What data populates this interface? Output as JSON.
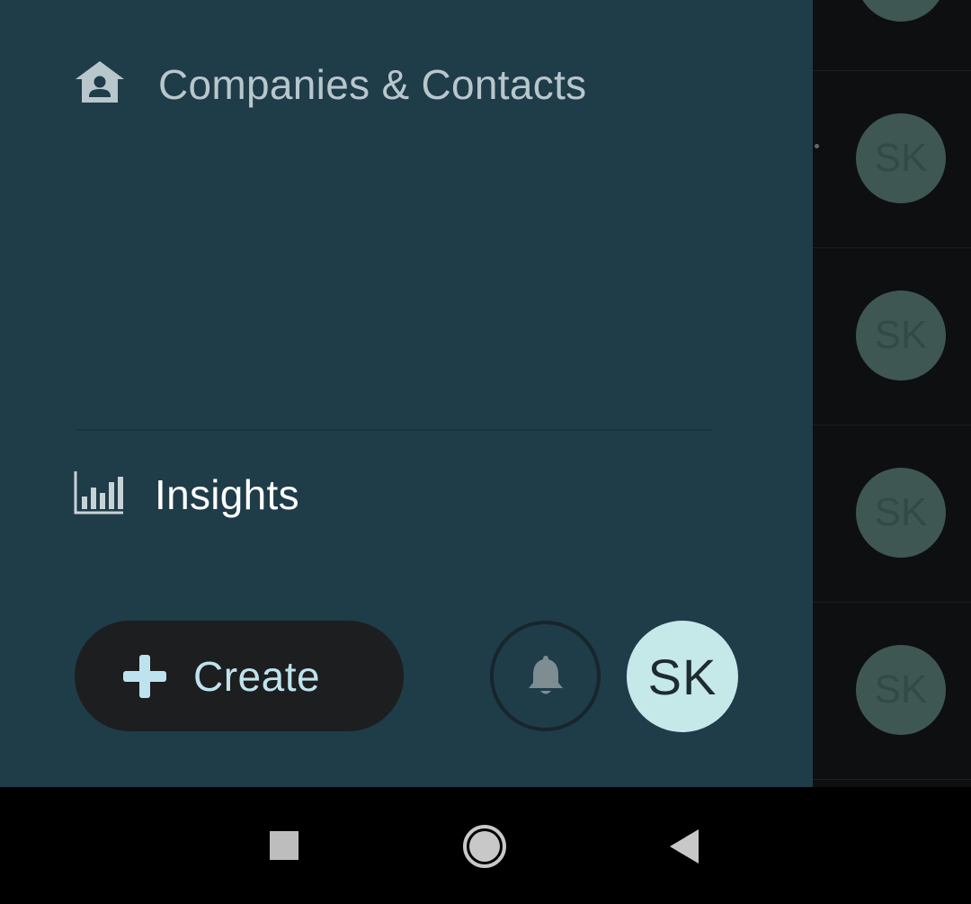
{
  "drawer": {
    "nav_items": [
      {
        "label": "Companies & Contacts",
        "icon": "house-person-icon"
      },
      {
        "label": "Insights",
        "icon": "bar-chart-icon"
      }
    ],
    "create_button": {
      "label": "Create",
      "icon": "plus-icon"
    },
    "notifications_icon": "bell-icon",
    "user_avatar": {
      "initials": "SK"
    }
  },
  "background_list": {
    "avatars": [
      {
        "initials": ""
      },
      {
        "initials": "SK"
      },
      {
        "initials": "SK"
      },
      {
        "initials": "SK"
      },
      {
        "initials": "SK"
      }
    ]
  },
  "system_nav": {
    "buttons": [
      "recents",
      "home",
      "back"
    ]
  },
  "colors": {
    "drawer_bg": "#1f3c49",
    "accent": "#bfe3ee",
    "avatar_bg": "#c5e8e9"
  }
}
